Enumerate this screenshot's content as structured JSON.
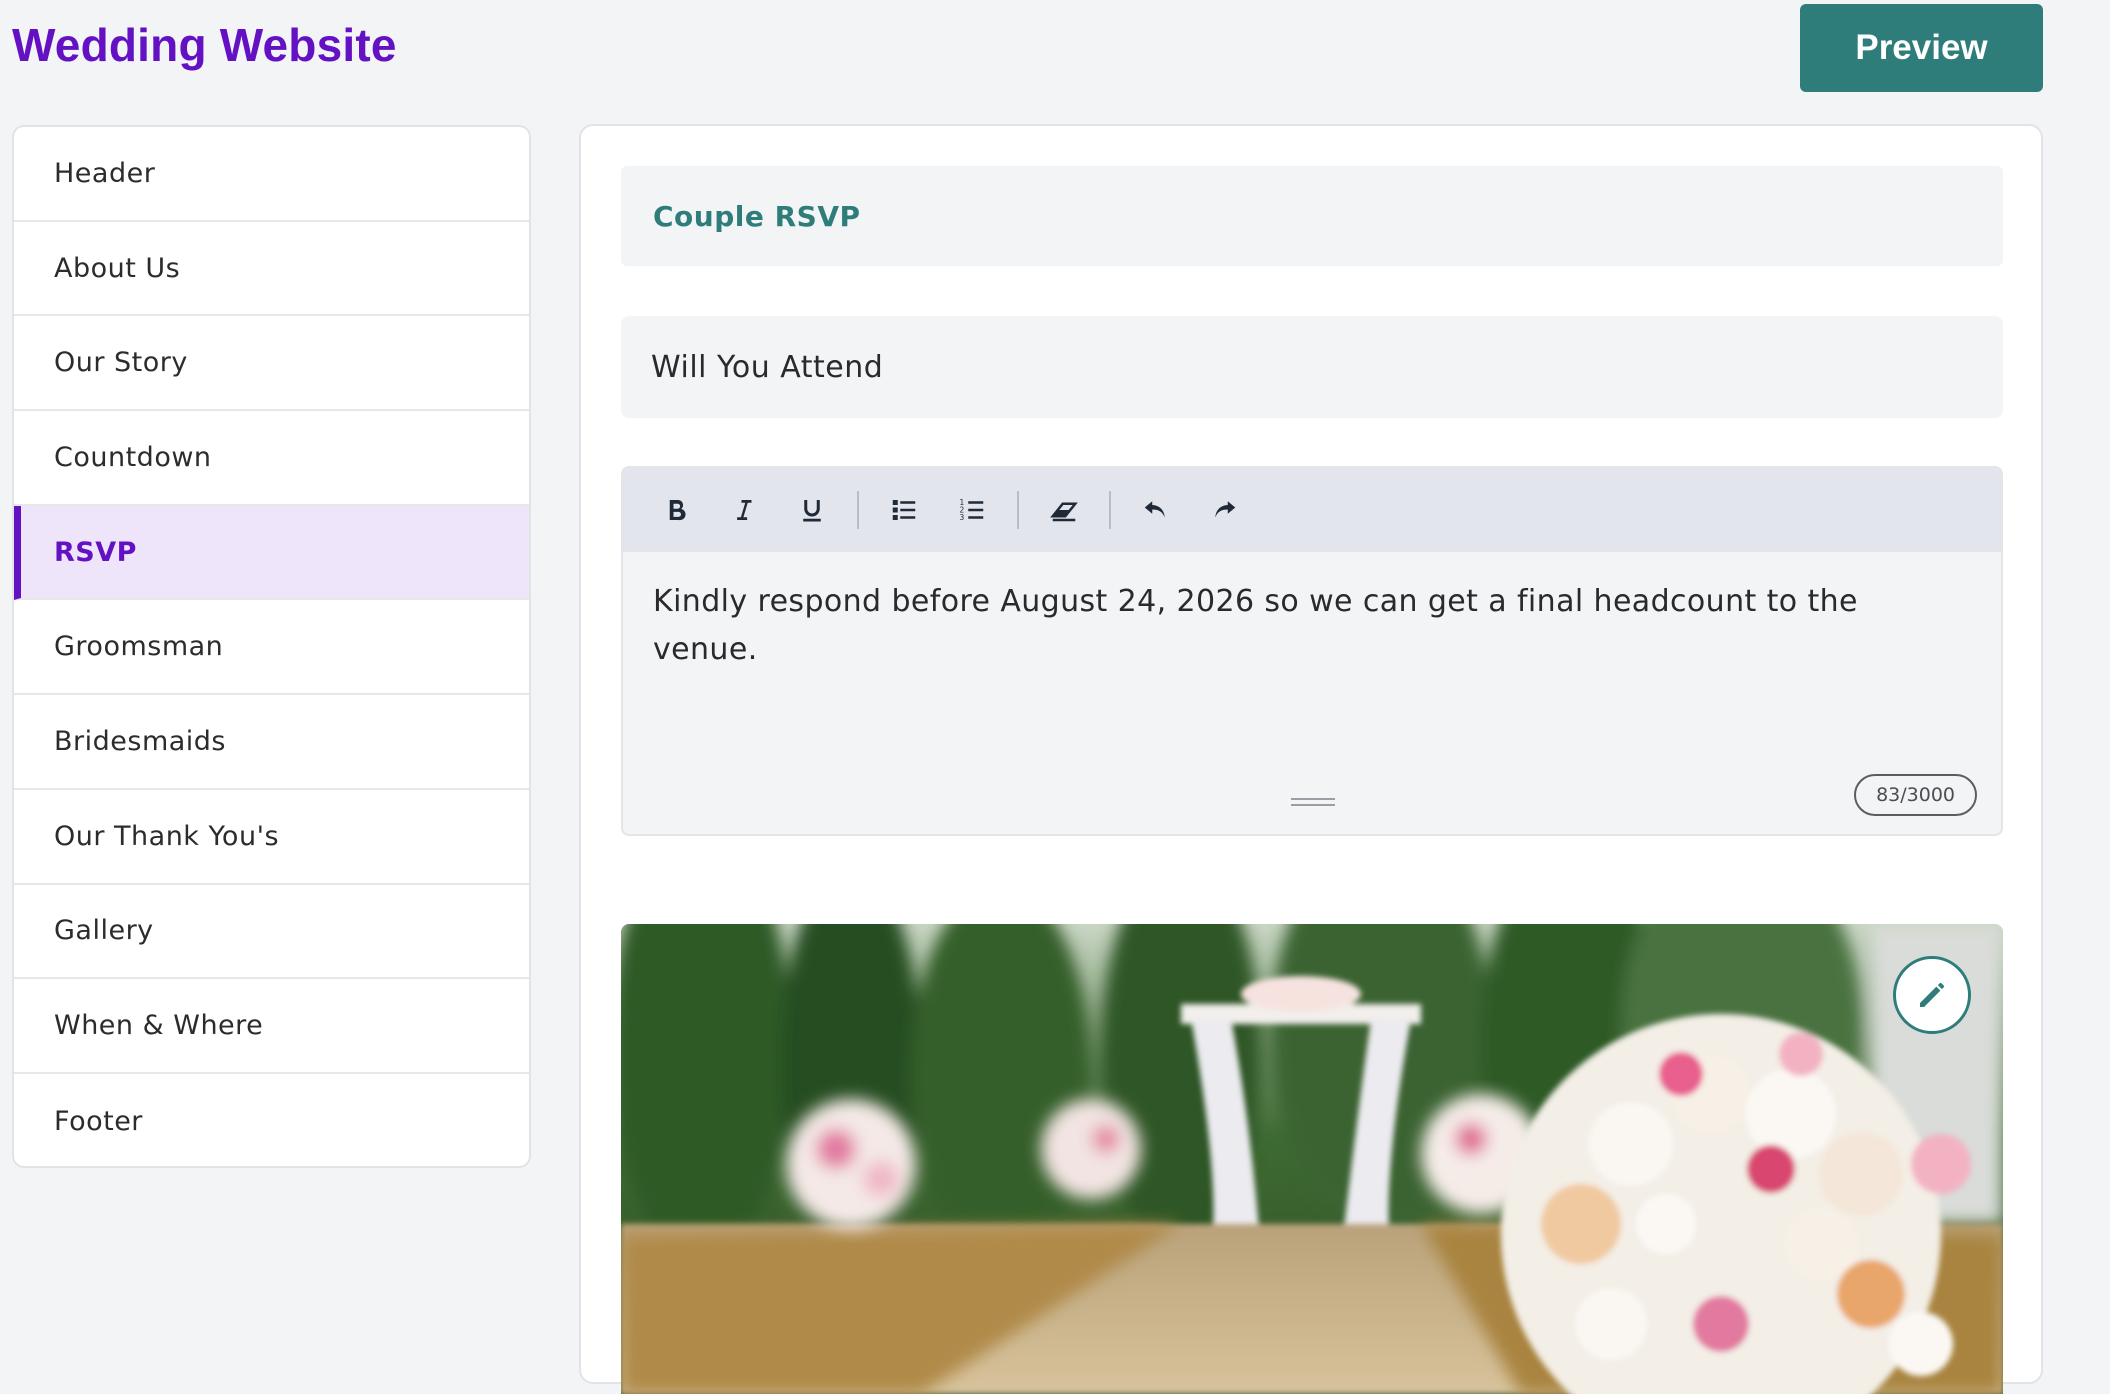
{
  "app": {
    "title": "Wedding Website"
  },
  "header": {
    "preview_label": "Preview"
  },
  "sidebar": {
    "items": [
      {
        "label": "Header"
      },
      {
        "label": "About Us"
      },
      {
        "label": "Our Story"
      },
      {
        "label": "Countdown"
      },
      {
        "label": "RSVP",
        "active": true
      },
      {
        "label": "Groomsman"
      },
      {
        "label": "Bridesmaids"
      },
      {
        "label": "Our Thank You's"
      },
      {
        "label": "Gallery"
      },
      {
        "label": "When & Where"
      },
      {
        "label": "Footer"
      }
    ]
  },
  "main": {
    "section_title": "Couple RSVP",
    "title_field": {
      "value": "Will You Attend"
    },
    "editor": {
      "toolbar": [
        "bold-icon",
        "italic-icon",
        "underline-icon",
        "bullet-list-icon",
        "numbered-list-icon",
        "eraser-icon",
        "undo-icon",
        "redo-icon"
      ],
      "text": "Kindly respond before August 24, 2026 so we can get a final headcount to the venue.",
      "char_count": "83/3000"
    },
    "photo": {
      "edit_icon": "pencil-icon"
    }
  },
  "colors": {
    "brand_purple": "#6411c4",
    "accent_teal": "#2e7d7a",
    "active_bg": "#efe5fb"
  }
}
